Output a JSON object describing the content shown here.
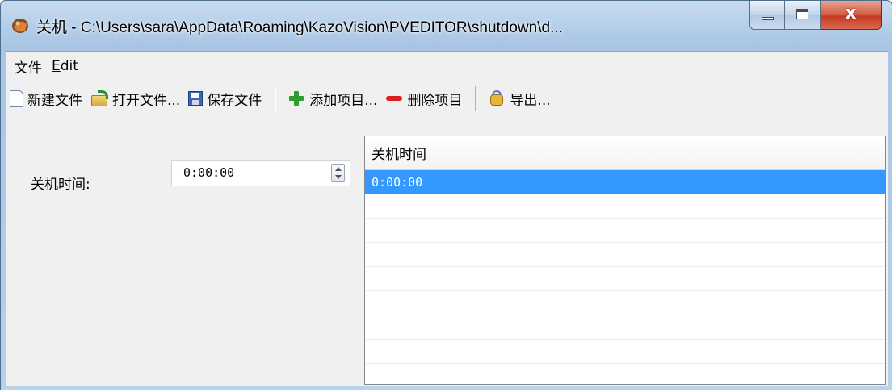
{
  "window": {
    "title": "关机 - C:\\Users\\sara\\AppData\\Roaming\\KazoVision\\PVEDITOR\\shutdown\\d...",
    "close_glyph": "x"
  },
  "menu": {
    "file": "文件",
    "edit_mnemonic": "E",
    "edit_rest": "dit"
  },
  "toolbar": {
    "new_file": "新建文件",
    "open_file": "打开文件...",
    "save_file": "保存文件",
    "add_item": "添加项目...",
    "delete_item": "删除项目",
    "export": "导出..."
  },
  "form": {
    "label": "关机时间:",
    "time_value": "0:00:00"
  },
  "list": {
    "column_header": "关机时间",
    "rows": [
      {
        "time": "0:00:00",
        "selected": true
      }
    ]
  },
  "colors": {
    "selection": "#3399ff",
    "add_icon": "#2f9e2f",
    "delete_icon": "#d92020"
  },
  "icons": {
    "app": "app-icon",
    "new": "new-file-icon",
    "open": "open-folder-icon",
    "save": "save-disk-icon",
    "add": "plus-icon",
    "delete": "minus-icon",
    "export": "export-icon"
  }
}
